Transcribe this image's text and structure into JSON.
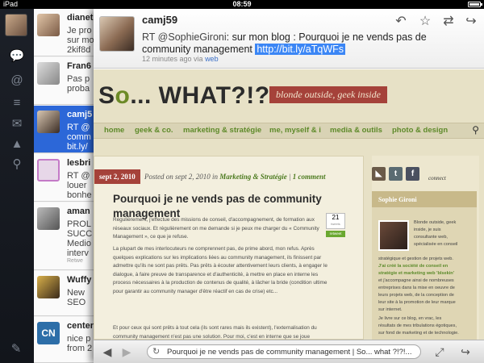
{
  "status_bar": {
    "carrier": "iPad",
    "time": "08:59"
  },
  "sidebar": {
    "icons": [
      "bubble-icon",
      "at-icon",
      "list-icon",
      "envelope-icon",
      "person-icon",
      "search-icon"
    ],
    "compose_icon": "compose-icon"
  },
  "timeline": {
    "tweets": [
      {
        "name": "dianet",
        "lines": [
          "Je pro",
          "sur mo",
          "2kif8d"
        ]
      },
      {
        "name": "Fran6",
        "lines": [
          "Pas p",
          "proba"
        ]
      },
      {
        "name": "camj5",
        "lines": [
          "RT @",
          "comm",
          "bit.ly/"
        ]
      },
      {
        "name": "lesbri",
        "lines": [
          "RT @",
          "louer",
          "bonhe"
        ]
      },
      {
        "name": "aman",
        "lines": [
          "PROL",
          "SUCC",
          "Medio",
          "interv",
          "Retwe"
        ]
      },
      {
        "name": "Wuffy",
        "lines": [
          "New",
          "SEO"
        ]
      },
      {
        "name": "center",
        "lines": [
          "nice p",
          "from 2"
        ]
      }
    ]
  },
  "detail": {
    "username": "camj59",
    "tweet_mention": "RT @SophieGironi",
    "tweet_body": ": sur mon blog : Pourquoi je ne vends pas de community management ",
    "tweet_link": "http://bit.ly/aTqWFs",
    "timestamp": "12 minutes ago",
    "via_label": " via ",
    "via_app": "web",
    "actions": [
      "reply-icon",
      "star-icon",
      "retweet-icon",
      "share-icon"
    ]
  },
  "site": {
    "title_prefix": "S",
    "title_o": "o",
    "title_rest": "... WHAT?!?!",
    "tagline": "blonde outside, geek inside",
    "nav": [
      "home",
      "geek & co.",
      "marketing & stratégie",
      "me, myself & i",
      "media & outils",
      "photo & design"
    ],
    "post": {
      "date_badge": "sept 2, 2010",
      "meta_prefix": "Posted on sept 2, 2010 in",
      "meta_category": "Marketing & Stratégie",
      "meta_sep": " | ",
      "meta_comments": "1 comment",
      "title": "Pourquoi je ne vends pas de community management",
      "tweet_count": "21",
      "tweet_count_label": "tweets",
      "retweet_label": "retweet",
      "paragraphs": [
        "Régulièrement, j'effectue des missions de conseil, d'accompagnement, de formation aux réseaux sociaux. Et régulièrement on me demande si je peux me charger du « Community Management », ce que je refuse.",
        "La plupart de mes interlocuteurs ne comprennent pas, de prime abord, mon refus. Après quelques explications sur les implications liées au community management, ils finissent par admettre qu'ils ne sont pas prêts. Pas prêts à écouter attentivement leurs clients, à engager le dialogue, à faire preuve de transparence et d'authenticité, à mettre en place en interne les process nécessaires à la production de contenus de qualité, à lâcher la bride (condition ultime pour garantir au community manager d'être réactif en cas de crise) etc...",
        "Et pour ceux qui sont prêts à tout cela (ils sont rares mais ils existent), l'externalisation du community management n'est pas une solution. Pour moi, c'est en interne que se joue"
      ]
    },
    "sidebar": {
      "connect_label": "connect",
      "about_name": "Sophie Gironi",
      "about_lines_right": [
        "Blonde outside, geek",
        "inside, je suis",
        "consultante web,",
        "spécialisée en conseil",
        "stratégique et gestion de projets web."
      ],
      "about_highlight": [
        "J'ai créé la société de conseil en",
        "stratégie et marketing web 'blsekin'"
      ],
      "about_lines_rest": [
        "et j'accompagne ainsi de nombreuses",
        "entreprises dans la mise en oeuvre de",
        "leurs projets web, de la conception de",
        "leur site à la promotion de leur marque",
        "sur internet.",
        "Je livre sur ce blog, en vrac, les",
        "résultats de mes tribulations égotiques,",
        "sur fond de marketing et de technologie."
      ]
    }
  },
  "toolbar": {
    "page_title": "Pourquoi je ne vends pas de community management | So... what ?!?!..."
  }
}
